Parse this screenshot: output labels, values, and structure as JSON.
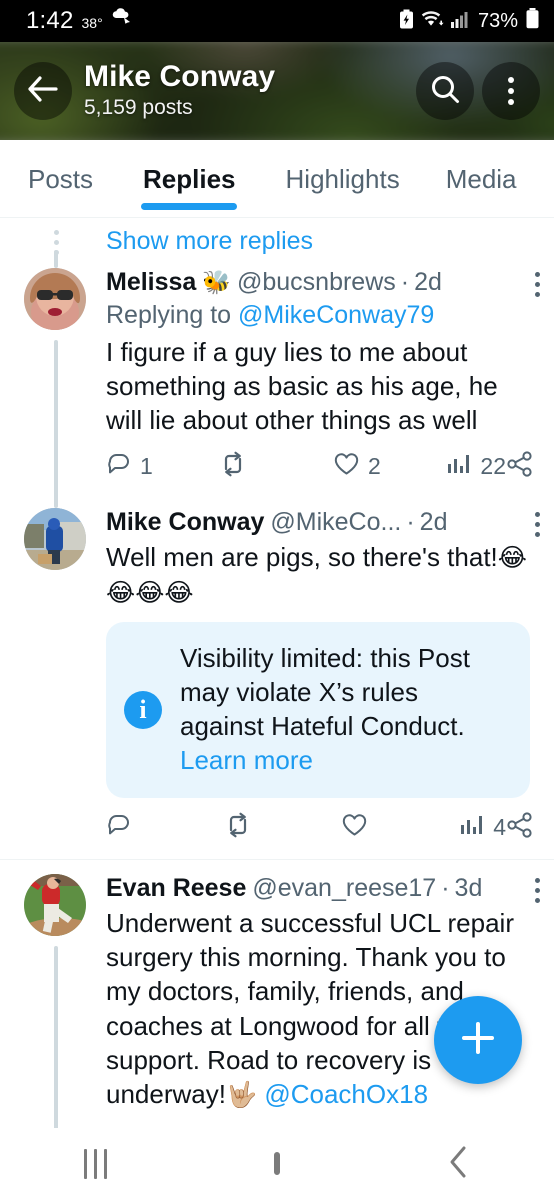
{
  "status_bar": {
    "time": "1:42",
    "temperature": "38°",
    "weather_icon": "weather-icon",
    "battery_percent": "73%",
    "icons": [
      "battery-saver-icon",
      "wifi-icon",
      "cellular-signal-icon",
      "battery-icon"
    ]
  },
  "header": {
    "back_icon": "back-arrow-icon",
    "name": "Mike Conway",
    "posts_count": "5,159 posts",
    "search_icon": "search-icon",
    "more_icon": "more-options-icon"
  },
  "tabs": [
    {
      "label": "Posts",
      "active": false
    },
    {
      "label": "Replies",
      "active": true
    },
    {
      "label": "Highlights",
      "active": false
    },
    {
      "label": "Media",
      "active": false
    }
  ],
  "feed": {
    "show_more_replies": "Show more replies",
    "tweets": [
      {
        "id": "tweet-melissa",
        "display_name": "Melissa",
        "name_emoji": "🐝",
        "handle": "@bucsnbrews",
        "separator": "·",
        "timestamp": "2d",
        "replying_to_label": "Replying to",
        "replying_to_handle": "@MikeConway79",
        "text": "I figure if a guy lies to me about something as basic as his age, he will lie about other things as well",
        "actions": {
          "reply": "1",
          "repost": "",
          "like": "2",
          "views": "22",
          "share": ""
        }
      },
      {
        "id": "tweet-mike-conway",
        "display_name": "Mike Conway",
        "name_emoji": "",
        "handle": "@MikeCo...",
        "separator": "·",
        "timestamp": "2d",
        "text": "Well men are pigs, so there's that!",
        "text_emoji": "😂😂😂😂",
        "notice": {
          "icon": "info-icon",
          "text": "Visibility limited: this Post may violate X’s rules against Hateful Conduct.",
          "link": "Learn more"
        },
        "actions": {
          "reply": "",
          "repost": "",
          "like": "",
          "views": "4",
          "share": ""
        }
      },
      {
        "id": "tweet-evan-reese",
        "display_name": "Evan Reese",
        "name_emoji": "",
        "handle": "@evan_reese17",
        "separator": "·",
        "timestamp": "3d",
        "text": "Underwent a successful UCL repair surgery this morning. Thank you to my doctors, family, friends, and coaches at Longwood for all the support. Road to recovery is underway!",
        "text_emoji": "🤟🏼",
        "mention": "@CoachOx18"
      }
    ]
  },
  "compose_button": {
    "icon": "plus-icon",
    "label": "+"
  },
  "nav_bar": {
    "recents_icon": "recents-icon",
    "home_icon": "home-icon",
    "back_icon": "back-icon"
  },
  "colors": {
    "accent": "#1d9bf0",
    "text_primary": "#0f1419",
    "text_secondary": "#536471",
    "notice_bg": "#e8f5fd",
    "divider": "#eff3f4"
  }
}
